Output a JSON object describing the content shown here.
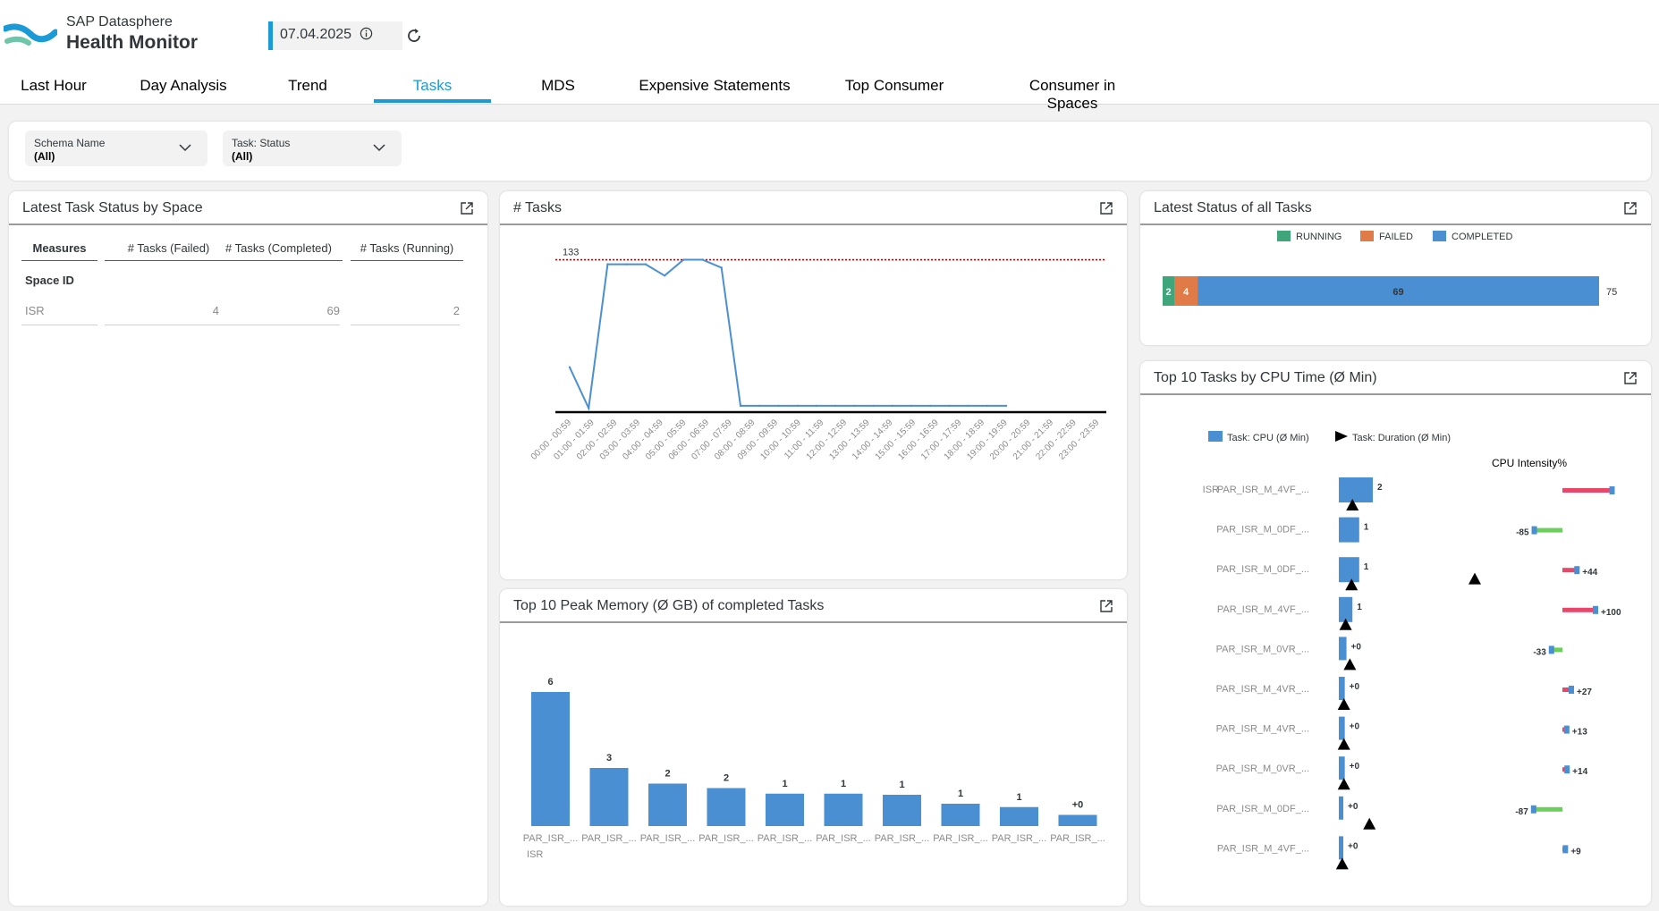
{
  "app": {
    "subtitle": "SAP Datasphere",
    "title": "Health Monitor"
  },
  "date": {
    "value": "07.04.2025"
  },
  "tabs": [
    {
      "label": "Last Hour",
      "active": false
    },
    {
      "label": "Day Analysis",
      "active": false
    },
    {
      "label": "Trend",
      "active": false
    },
    {
      "label": "Tasks",
      "active": true
    },
    {
      "label": "MDS",
      "active": false
    },
    {
      "label": "Expensive Statements",
      "active": false
    },
    {
      "label": "Top Consumer",
      "active": false
    },
    {
      "label": "Consumer in Spaces",
      "active": false
    }
  ],
  "filters": {
    "schema": {
      "label": "Schema Name",
      "value": "(All)"
    },
    "status": {
      "label": "Task: Status",
      "value": "(All)"
    }
  },
  "colors": {
    "accent": "#1a9bd7",
    "bar": "#4a8fd2",
    "running": "#3fa57a",
    "failed": "#e07b47",
    "completed": "#4a8fd2",
    "line": "#4a8fd2",
    "threshold": "#bb0000",
    "cpu_pos": "#e8476a",
    "cpu_neg": "#6bcf5c"
  },
  "task_status_table": {
    "title": "Latest Task Status by Space",
    "measures_label": "Measures",
    "columns": [
      "# Tasks (Failed)",
      "# Tasks (Completed)",
      "# Tasks (Running)"
    ],
    "row_header": "Space ID",
    "rows": [
      {
        "space": "ISR",
        "values": [
          "4",
          "69",
          "2"
        ]
      }
    ]
  },
  "tasks_chart": {
    "title": "# Tasks",
    "threshold_label": "133",
    "chart_data": {
      "type": "line",
      "title": "# Tasks",
      "categories": [
        "00:00 - 00:59",
        "01:00 - 01:59",
        "02:00 - 02:59",
        "03:00 - 03:59",
        "04:00 - 04:59",
        "05:00 - 05:59",
        "06:00 - 06:59",
        "07:00 - 07:59",
        "08:00 - 08:59",
        "09:00 - 09:59",
        "10:00 - 10:59",
        "11:00 - 11:59",
        "12:00 - 12:59",
        "13:00 - 13:59",
        "14:00 - 14:59",
        "15:00 - 15:59",
        "16:00 - 16:59",
        "17:00 - 17:59",
        "18:00 - 18:59",
        "19:00 - 19:59",
        "20:00 - 20:59",
        "21:00 - 21:59",
        "22:00 - 22:59",
        "23:00 - 23:59"
      ],
      "series": [
        {
          "values": [
            38,
            2,
            129,
            129,
            129,
            119,
            133,
            133,
            126,
            4,
            4,
            4,
            4,
            4,
            4,
            4,
            4,
            4,
            4,
            4,
            4,
            4,
            4,
            4
          ]
        }
      ],
      "reference_line": 133,
      "ylim": [
        0,
        150
      ]
    }
  },
  "status_all": {
    "title": "Latest Status of all Tasks",
    "legend": [
      "RUNNING",
      "FAILED",
      "COMPLETED"
    ],
    "total_label": "75",
    "chart_data": {
      "type": "bar",
      "orientation": "stacked-horizontal",
      "series": [
        {
          "name": "RUNNING",
          "values": [
            2
          ]
        },
        {
          "name": "FAILED",
          "values": [
            4
          ]
        },
        {
          "name": "COMPLETED",
          "values": [
            69
          ]
        }
      ],
      "total": 75
    }
  },
  "peak_memory": {
    "title": "Top 10 Peak Memory (Ø GB) of completed Tasks",
    "group_label": "ISR",
    "chart_data": {
      "type": "bar",
      "categories": [
        "PAR_ISR_...",
        "PAR_ISR_...",
        "PAR_ISR_...",
        "PAR_ISR_...",
        "PAR_ISR_...",
        "PAR_ISR_...",
        "PAR_ISR_...",
        "PAR_ISR_...",
        "PAR_ISR_...",
        "PAR_ISR_..."
      ],
      "values": [
        6.0,
        2.6,
        1.9,
        1.7,
        1.45,
        1.45,
        1.4,
        1.0,
        0.85,
        0.5
      ],
      "data_labels": [
        "6",
        "3",
        "2",
        "2",
        "1",
        "1",
        "1",
        "1",
        "1",
        "+0"
      ]
    }
  },
  "cpu_time": {
    "title": "Top 10 Tasks by CPU Time (Ø Min)",
    "legend_cpu": "Task: CPU (Ø Min)",
    "legend_duration": "Task: Duration (Ø Min)",
    "intensity_header": "CPU Intensity%",
    "group_label": "ISR",
    "chart_data": {
      "type": "bar",
      "categories": [
        "PAR_ISR_M_4VF_...",
        "PAR_ISR_M_0DF_...",
        "PAR_ISR_M_0DF_...",
        "PAR_ISR_M_4VF_...",
        "PAR_ISR_M_0VR_...",
        "PAR_ISR_M_4VR_...",
        "PAR_ISR_M_4VR_...",
        "PAR_ISR_M_0VR_...",
        "PAR_ISR_M_0DF_...",
        "PAR_ISR_M_4VF_..."
      ],
      "cpu": [
        2.0,
        1.2,
        1.2,
        0.8,
        0.45,
        0.35,
        0.35,
        0.35,
        0.25,
        0.2
      ],
      "cpu_labels": [
        "2",
        "1",
        "1",
        "1",
        "+0",
        "+0",
        "+0",
        "+0",
        "+0",
        "+0"
      ],
      "duration": [
        0.8,
        8.0,
        0.75,
        0.4,
        0.65,
        0.3,
        0.3,
        0.3,
        1.8,
        0.2
      ],
      "intensity": [
        150,
        -85,
        44,
        100,
        -33,
        27,
        13,
        14,
        -87,
        9
      ],
      "intensity_labels": [
        "",
        "-85",
        "+44",
        "+100",
        "-33",
        "+27",
        "+13",
        "+14",
        "-87",
        "+9"
      ]
    }
  }
}
